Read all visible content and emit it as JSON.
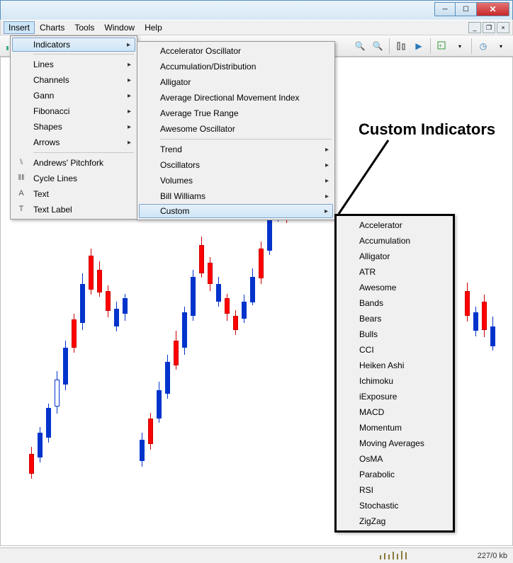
{
  "menubar": {
    "items": [
      "Insert",
      "Charts",
      "Tools",
      "Window",
      "Help"
    ]
  },
  "insert_menu": {
    "indicators": "Indicators",
    "lines": "Lines",
    "channels": "Channels",
    "gann": "Gann",
    "fibonacci": "Fibonacci",
    "shapes": "Shapes",
    "arrows": "Arrows",
    "andrews": "Andrews' Pitchfork",
    "cycle": "Cycle Lines",
    "text": "Text",
    "textlabel": "Text Label"
  },
  "indicators_menu": {
    "accelerator": "Accelerator Oscillator",
    "accumulation": "Accumulation/Distribution",
    "alligator": "Alligator",
    "adx": "Average Directional Movement Index",
    "atr": "Average True Range",
    "awesome": "Awesome Oscillator",
    "trend": "Trend",
    "oscillators": "Oscillators",
    "volumes": "Volumes",
    "billwilliams": "Bill Williams",
    "custom": "Custom"
  },
  "custom_menu": {
    "items": [
      "Accelerator",
      "Accumulation",
      "Alligator",
      "ATR",
      "Awesome",
      "Bands",
      "Bears",
      "Bulls",
      "CCI",
      "Heiken Ashi",
      "Ichimoku",
      "iExposure",
      "MACD",
      "Momentum",
      "Moving Averages",
      "OsMA",
      "Parabolic",
      "RSI",
      "Stochastic",
      "ZigZag"
    ]
  },
  "annotation": "Custom Indicators",
  "status": {
    "kb": "227/0 kb"
  }
}
